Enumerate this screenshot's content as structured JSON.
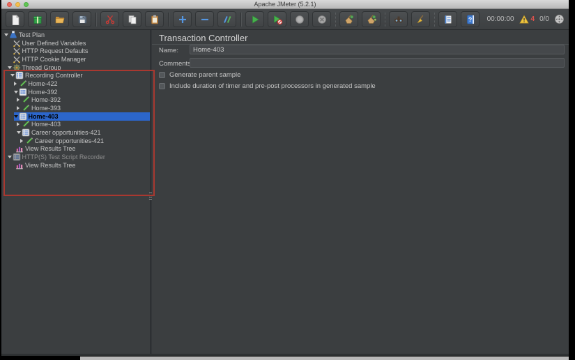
{
  "window": {
    "title": "Apache JMeter (5.2.1)"
  },
  "toolbar": {
    "groups": [
      [
        "new-file",
        "templates",
        "open-file",
        "save"
      ],
      [
        "cut",
        "copy",
        "paste"
      ],
      [
        "add",
        "remove",
        "toggle"
      ],
      [
        "start",
        "start-no-timers",
        "stop",
        "shutdown"
      ],
      [
        "clear",
        "clear-all"
      ],
      [
        "search",
        "search-reset"
      ],
      [
        "function-helper",
        "help"
      ]
    ],
    "timer": "00:00:00",
    "log_error_count": "4",
    "thread_count": "0/0"
  },
  "tree": {
    "items": [
      {
        "label": "Test Plan",
        "icon": "test-plan",
        "level": 0,
        "arrow": "open",
        "selected": false,
        "disabled": false
      },
      {
        "label": "User Defined Variables",
        "icon": "config",
        "level": 1,
        "arrow": "none",
        "selected": false,
        "disabled": false
      },
      {
        "label": "HTTP Request Defaults",
        "icon": "config",
        "level": 1,
        "arrow": "none",
        "selected": false,
        "disabled": false
      },
      {
        "label": "HTTP Cookie Manager",
        "icon": "config",
        "level": 1,
        "arrow": "none",
        "selected": false,
        "disabled": false
      },
      {
        "label": "Thread Group",
        "icon": "thread-group",
        "level": 1,
        "arrow": "open",
        "selected": false,
        "disabled": false
      },
      {
        "label": "Recording Controller",
        "icon": "controller",
        "level": 2,
        "arrow": "open",
        "selected": false,
        "disabled": false
      },
      {
        "label": "Home-422",
        "icon": "sampler",
        "level": 3,
        "arrow": "closed",
        "selected": false,
        "disabled": false
      },
      {
        "label": "Home-392",
        "icon": "controller",
        "level": 3,
        "arrow": "open",
        "selected": false,
        "disabled": false
      },
      {
        "label": "Home-392",
        "icon": "sampler",
        "level": 4,
        "arrow": "closed",
        "selected": false,
        "disabled": false
      },
      {
        "label": "Home-393",
        "icon": "sampler",
        "level": 4,
        "arrow": "closed",
        "selected": false,
        "disabled": false
      },
      {
        "label": "Home-403",
        "icon": "controller",
        "level": 3,
        "arrow": "open",
        "selected": true,
        "disabled": false
      },
      {
        "label": "Home-403",
        "icon": "sampler",
        "level": 4,
        "arrow": "closed",
        "selected": false,
        "disabled": false
      },
      {
        "label": "Career opportunities-421",
        "icon": "controller",
        "level": 4,
        "arrow": "open",
        "selected": false,
        "disabled": false
      },
      {
        "label": "Career opportunities-421",
        "icon": "sampler",
        "level": 5,
        "arrow": "closed",
        "selected": false,
        "disabled": false
      },
      {
        "label": "View Results Tree",
        "icon": "results-tree",
        "level": 2,
        "arrow": "none",
        "selected": false,
        "disabled": false
      },
      {
        "label": "HTTP(S) Test Script Recorder",
        "icon": "controller",
        "level": 1,
        "arrow": "open",
        "selected": false,
        "disabled": true
      },
      {
        "label": "View Results Tree",
        "icon": "results-tree",
        "level": 2,
        "arrow": "none",
        "selected": false,
        "disabled": false
      }
    ]
  },
  "main": {
    "title": "Transaction Controller",
    "name_label": "Name:",
    "name_value": "Home-403",
    "comments_label": "Comments:",
    "comments_value": "",
    "checkboxes": [
      {
        "label": "Generate parent sample",
        "checked": false
      },
      {
        "label": "Include duration of timer and pre-post processors in generated sample",
        "checked": false
      }
    ]
  },
  "colors": {
    "selection_blue": "#2c66cb",
    "highlight_red": "#a93830",
    "warning_yellow": "#f0c53c",
    "error_count_red": "#e0524d"
  }
}
